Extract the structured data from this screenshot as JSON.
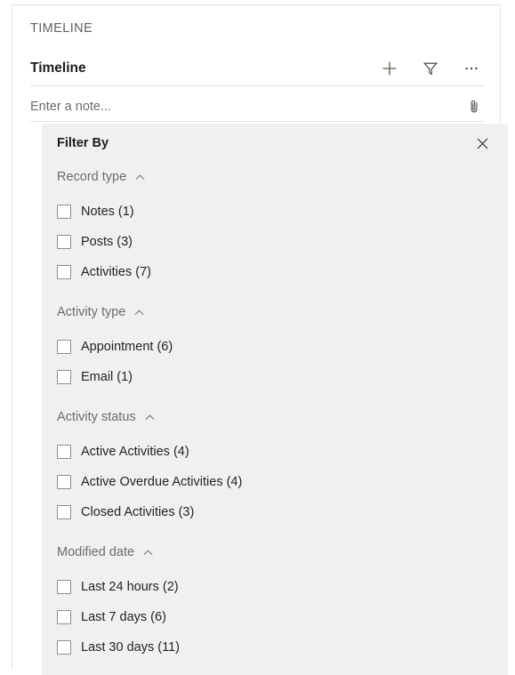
{
  "panel": {
    "eyebrow": "TIMELINE",
    "title": "Timeline",
    "actions": [
      {
        "name": "add-icon",
        "label": "Add"
      },
      {
        "name": "filter-icon",
        "label": "Filter"
      },
      {
        "name": "more-options-icon",
        "label": "More commands"
      }
    ],
    "note": {
      "placeholder": "Enter a note...",
      "value": "",
      "attach_label": "Attach"
    }
  },
  "filter": {
    "title": "Filter By",
    "close_label": "Close",
    "groups": [
      {
        "title": "Record type",
        "expanded": true,
        "options": [
          {
            "label": "Notes (1)",
            "checked": false
          },
          {
            "label": "Posts (3)",
            "checked": false
          },
          {
            "label": "Activities (7)",
            "checked": false
          }
        ]
      },
      {
        "title": "Activity type",
        "expanded": true,
        "options": [
          {
            "label": "Appointment (6)",
            "checked": false
          },
          {
            "label": "Email (1)",
            "checked": false
          }
        ]
      },
      {
        "title": "Activity status",
        "expanded": true,
        "options": [
          {
            "label": "Active Activities (4)",
            "checked": false
          },
          {
            "label": "Active Overdue Activities (4)",
            "checked": false
          },
          {
            "label": "Closed Activities (3)",
            "checked": false
          }
        ]
      },
      {
        "title": "Modified date",
        "expanded": true,
        "options": [
          {
            "label": "Last 24 hours (2)",
            "checked": false
          },
          {
            "label": "Last 7 days (6)",
            "checked": false
          },
          {
            "label": "Last 30 days (11)",
            "checked": false
          }
        ]
      }
    ]
  },
  "colors": {
    "card_bg": "#ffffff",
    "panel_bg": "#f0f0f0",
    "text_primary": "#242424",
    "text_secondary": "#6d6d6d",
    "border": "#e1e1e1"
  }
}
